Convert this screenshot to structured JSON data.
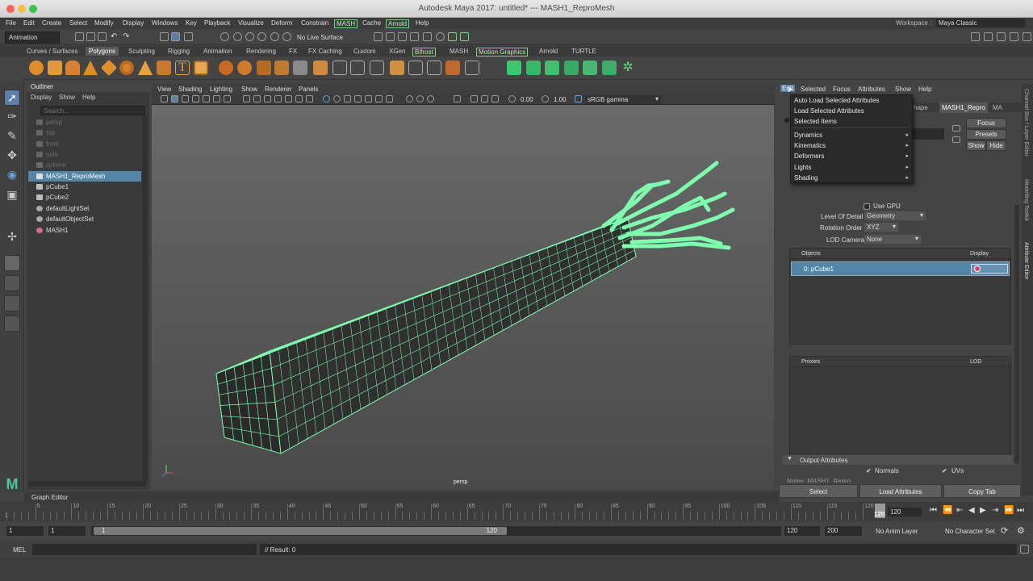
{
  "titlebar": {
    "title": "Autodesk Maya 2017: untitled*   ---   MASH1_ReproMesh"
  },
  "menubar": {
    "items": [
      "File",
      "Edit",
      "Create",
      "Select",
      "Modify",
      "Display",
      "Windows",
      "Key",
      "Playback",
      "Visualize",
      "Deform",
      "Constrain",
      "MASH",
      "Cache",
      "Arnold",
      "Help"
    ],
    "workspace_label": "Workspace :",
    "workspace_value": "Maya Classic"
  },
  "statusline": {
    "mode": "Animation",
    "live_surface": "No Live Surface"
  },
  "shelf": {
    "tabs": [
      "Curves / Surfaces",
      "Polygons",
      "Sculpting",
      "Rigging",
      "Animation",
      "Rendering",
      "FX",
      "FX Caching",
      "Custom",
      "XGen",
      "Bifrost",
      "MASH",
      "Motion Graphics",
      "Arnold",
      "TURTLE"
    ],
    "active_tab": "Polygons"
  },
  "outliner": {
    "title": "Outliner",
    "menu": [
      "Display",
      "Show",
      "Help"
    ],
    "search_placeholder": "Search...",
    "items": [
      {
        "label": "persp",
        "dim": true,
        "icon": "camera-icon"
      },
      {
        "label": "top",
        "dim": true,
        "icon": "camera-icon"
      },
      {
        "label": "front",
        "dim": true,
        "icon": "camera-icon"
      },
      {
        "label": "side",
        "dim": true,
        "icon": "camera-icon"
      },
      {
        "label": "sphere",
        "dim": true,
        "icon": "mesh-icon"
      },
      {
        "label": "MASH1_ReproMesh",
        "dim": false,
        "icon": "mesh-icon",
        "selected": true
      },
      {
        "label": "pCube1",
        "dim": false,
        "icon": "mesh-icon"
      },
      {
        "label": "pCube2",
        "dim": false,
        "icon": "mesh-icon"
      },
      {
        "label": "defaultLightSet",
        "dim": false,
        "icon": "set-icon"
      },
      {
        "label": "defaultObjectSet",
        "dim": false,
        "icon": "set-icon"
      },
      {
        "label": "MASH1",
        "dim": false,
        "icon": "mash-icon"
      }
    ]
  },
  "viewport": {
    "menu": [
      "View",
      "Shading",
      "Lighting",
      "Show",
      "Renderer",
      "Panels"
    ],
    "exposure": "0.00",
    "gamma": "1.00",
    "color_space": "sRGB gamma",
    "camera_label": "persp",
    "mesh_color": "#7dffae"
  },
  "attribute_editor": {
    "menu": [
      "Edit",
      "Selected",
      "Focus",
      "Attributes",
      "Show",
      "Help"
    ],
    "tabs": [
      "hape",
      "MASH1_Repro",
      "MA"
    ],
    "buttons": {
      "focus": "Focus",
      "presets": "Presets",
      "show": "Show",
      "hide": "Hide"
    },
    "popup": {
      "items": [
        "Auto Load Selected Attributes",
        "Load Selected Attributes",
        "Selected Items"
      ],
      "submenus": [
        "Dynamics",
        "Kinematics",
        "Deformers",
        "Lights",
        "Shading"
      ]
    },
    "use_gpu": "Use GPU",
    "level_of_detail_label": "Level Of Detail",
    "level_of_detail_value": "Geometry",
    "rotation_order_label": "Rotation Order",
    "rotation_order_value": "XYZ",
    "lod_camera_label": "LOD Camera",
    "lod_camera_value": "None",
    "objects_header": "Objects",
    "display_header": "Display",
    "object_row": "0:  pCube1",
    "proxies_header": "Proxies",
    "lod_header": "LOD",
    "output_attributes": "Output Attributes",
    "normals": "Normals",
    "uvs": "UVs",
    "notes": "Notes:  MASH1_Repro",
    "bottom_buttons": [
      "Select",
      "Load Attributes",
      "Copy Tab"
    ]
  },
  "side_tabs": [
    "Channel Box / Layer Editor",
    "Modelling Toolkit",
    "Attribute Editor"
  ],
  "graph_editor": {
    "label": "Graph Editor"
  },
  "time_slider": {
    "ticks": [
      "5",
      "10",
      "15",
      "20",
      "25",
      "30",
      "35",
      "40",
      "45",
      "50",
      "55",
      "60",
      "65",
      "70",
      "75",
      "80",
      "85",
      "90",
      "95",
      "100",
      "105",
      "110",
      "115",
      "120"
    ],
    "start_label": "1",
    "current_frame": "120",
    "current_field": "120"
  },
  "range_slider": {
    "start": "1",
    "start2": "1",
    "inner_start": "1",
    "inner_end": "120",
    "end": "120",
    "end2": "200",
    "anim_layer": "No Anim Layer",
    "character_set": "No Character Set"
  },
  "command_line": {
    "lang": "MEL",
    "result": "// Result: 0"
  }
}
